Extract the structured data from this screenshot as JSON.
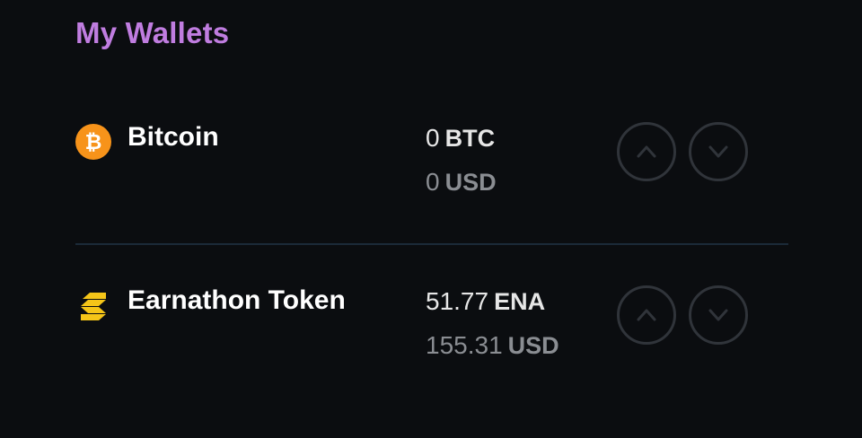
{
  "page": {
    "title": "My Wallets"
  },
  "wallets": [
    {
      "name": "Bitcoin",
      "icon": "bitcoin-icon",
      "icon_color": "#f7931a",
      "amount": "0",
      "symbol": "BTC",
      "fiat_amount": "0",
      "fiat_currency": "USD"
    },
    {
      "name": "Earnathon Token",
      "icon": "earnathon-token-icon",
      "icon_color": "#f5c518",
      "amount": "51.77",
      "symbol": "ENA",
      "fiat_amount": "155.31",
      "fiat_currency": "USD"
    }
  ],
  "colors": {
    "background": "#0b0d10",
    "title": "#c07de0",
    "button_border": "#30343a",
    "divider": "#1b2a38"
  },
  "actions": {
    "up_icon": "chevron-up-icon",
    "down_icon": "chevron-down-icon"
  }
}
